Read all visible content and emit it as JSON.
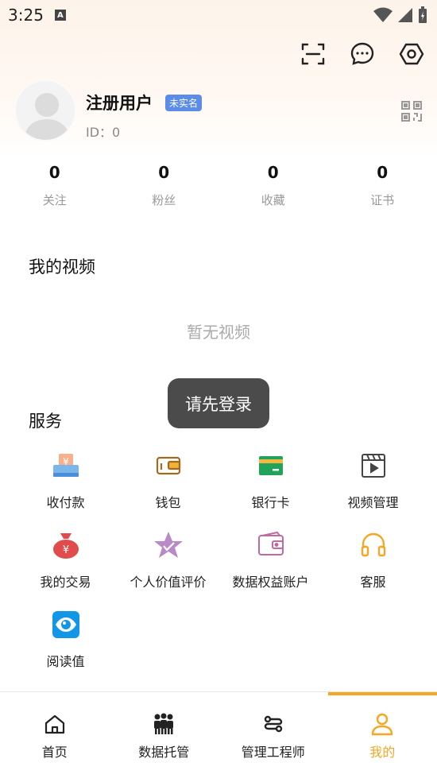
{
  "status_bar": {
    "time": "3:25",
    "notification_letter": "A"
  },
  "toolbar": {
    "icons": [
      "scan-icon",
      "message-icon",
      "settings-icon"
    ]
  },
  "profile": {
    "name": "注册用户",
    "badge": "未实名",
    "id_text": "ID：0"
  },
  "stats": [
    {
      "value": "0",
      "label": "关注"
    },
    {
      "value": "0",
      "label": "粉丝"
    },
    {
      "value": "0",
      "label": "收藏"
    },
    {
      "value": "0",
      "label": "证书"
    }
  ],
  "videos": {
    "title": "我的视频",
    "empty": "暂无视频"
  },
  "toast": "请先登录",
  "services": {
    "title": "服务",
    "items": [
      {
        "label": "收付款",
        "icon": "payment-icon"
      },
      {
        "label": "钱包",
        "icon": "wallet-icon"
      },
      {
        "label": "银行卡",
        "icon": "bank-card-icon"
      },
      {
        "label": "视频管理",
        "icon": "video-manage-icon"
      },
      {
        "label": "我的交易",
        "icon": "money-bag-icon"
      },
      {
        "label": "个人价值评价",
        "icon": "star-icon"
      },
      {
        "label": "数据权益账户",
        "icon": "data-account-icon"
      },
      {
        "label": "客服",
        "icon": "headset-icon"
      },
      {
        "label": "阅读值",
        "icon": "eye-icon"
      }
    ]
  },
  "bottom_nav": [
    {
      "label": "首页",
      "icon": "home-icon"
    },
    {
      "label": "数据托管",
      "icon": "group-icon"
    },
    {
      "label": "管理工程师",
      "icon": "route-icon"
    },
    {
      "label": "我的",
      "icon": "user-icon",
      "active": true
    }
  ],
  "colors": {
    "accent": "#f5a623",
    "badge": "#5b8de8",
    "toast_bg": "#4b4b4b"
  }
}
